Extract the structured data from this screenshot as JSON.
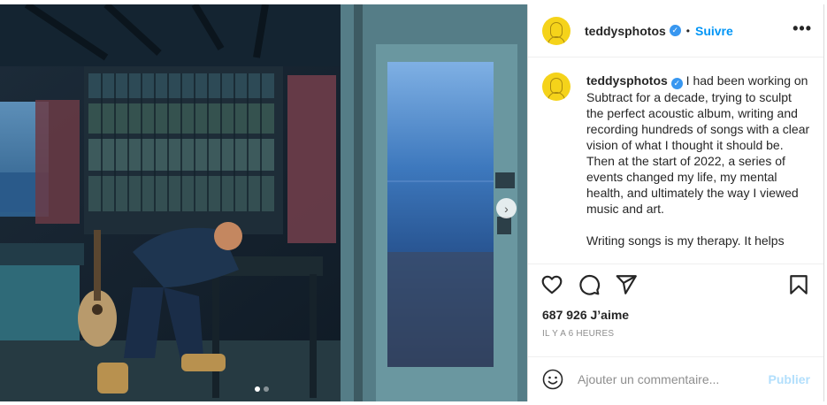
{
  "post": {
    "username": "teddysphotos",
    "verified_icon": "verified-badge-icon",
    "separator": "•",
    "follow_label": "Suivre",
    "more_icon": "more-options-icon",
    "more_glyph": "•••"
  },
  "media": {
    "slide_index": 1,
    "slide_count": 2,
    "next_icon": "chevron-right-icon",
    "next_glyph": "›"
  },
  "caption": {
    "username": "teddysphotos",
    "paragraph_1": "I had been working on Subtract for a decade, trying to sculpt the perfect acoustic album, writing and recording hundreds of songs with a clear vision of what I thought it should be. Then at the start of 2022, a series of events changed my life, my mental health, and ultimately the way I viewed music and art.",
    "paragraph_2": "Writing songs is my therapy. It helps"
  },
  "actions": {
    "like_icon": "heart-icon",
    "comment_icon": "comment-icon",
    "share_icon": "share-icon",
    "save_icon": "bookmark-icon",
    "likes_text": "687 926 J’aime",
    "timestamp": "IL Y A 6 HEURES"
  },
  "comment_box": {
    "emoji_icon": "smiley-icon",
    "placeholder": "Ajouter un commentaire...",
    "publish_label": "Publier"
  },
  "colors": {
    "accent": "#0095f6",
    "publish_disabled": "#b2dffc",
    "avatar_yellow": "#f5d31a",
    "muted": "#8e8e8e"
  }
}
